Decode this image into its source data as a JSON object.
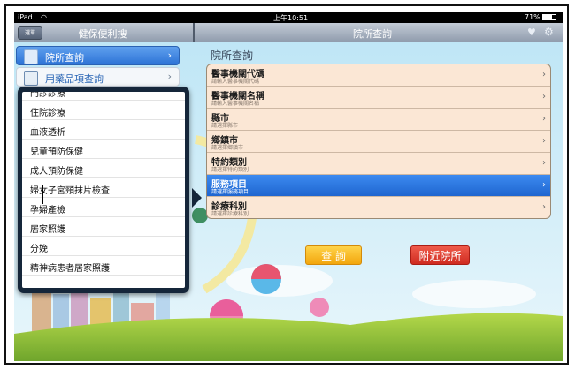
{
  "status_bar": {
    "device": "iPad",
    "time": "上午10:51",
    "battery": "71%"
  },
  "nav": {
    "back_label": "選單",
    "left_title": "健保便利搜",
    "right_title": "院所查詢"
  },
  "sidebar": {
    "items": [
      {
        "label": "院所查詢",
        "active": true
      },
      {
        "label": "用藥品項查詢",
        "active": false
      }
    ]
  },
  "popover": {
    "items": [
      {
        "label": "門診診療"
      },
      {
        "label": "住院診療"
      },
      {
        "label": "血液透析"
      },
      {
        "label": "兒童預防保健"
      },
      {
        "label": "成人預防保健"
      },
      {
        "label": "婦女子宮頸抹片檢查"
      },
      {
        "label": "孕婦產檢"
      },
      {
        "label": "居家照護"
      },
      {
        "label": "分娩"
      },
      {
        "label": "精神病患者居家照護"
      }
    ]
  },
  "main": {
    "section_title": "院所查詢",
    "fields": [
      {
        "label": "醫事機關代碼",
        "placeholder": "請輸入醫事機關代碼",
        "selected": false
      },
      {
        "label": "醫事機關名稱",
        "placeholder": "請輸入醫事機關名稱",
        "selected": false
      },
      {
        "label": "縣市",
        "placeholder": "請選擇縣市",
        "selected": false
      },
      {
        "label": "鄉鎮市",
        "placeholder": "請選擇鄉鎮市",
        "selected": false
      },
      {
        "label": "特約類別",
        "placeholder": "請選擇特約類別",
        "selected": false
      },
      {
        "label": "服務項目",
        "placeholder": "請選擇服務項目",
        "selected": true
      },
      {
        "label": "診療科別",
        "placeholder": "請選擇診療科別",
        "selected": false
      }
    ],
    "query_button": "查 詢",
    "nearby_button": "附近院所"
  },
  "icons": {
    "back": "back-button",
    "heart": "heart-icon",
    "gear": "gear-icon",
    "chevron": "chevron-right-icon"
  },
  "colors": {
    "accent_blue": "#2d73d6",
    "form_bg": "#fbe7d5",
    "query_orange": "#f2a60d",
    "nearby_red": "#cf2b20",
    "popover_dark": "#15263a"
  }
}
